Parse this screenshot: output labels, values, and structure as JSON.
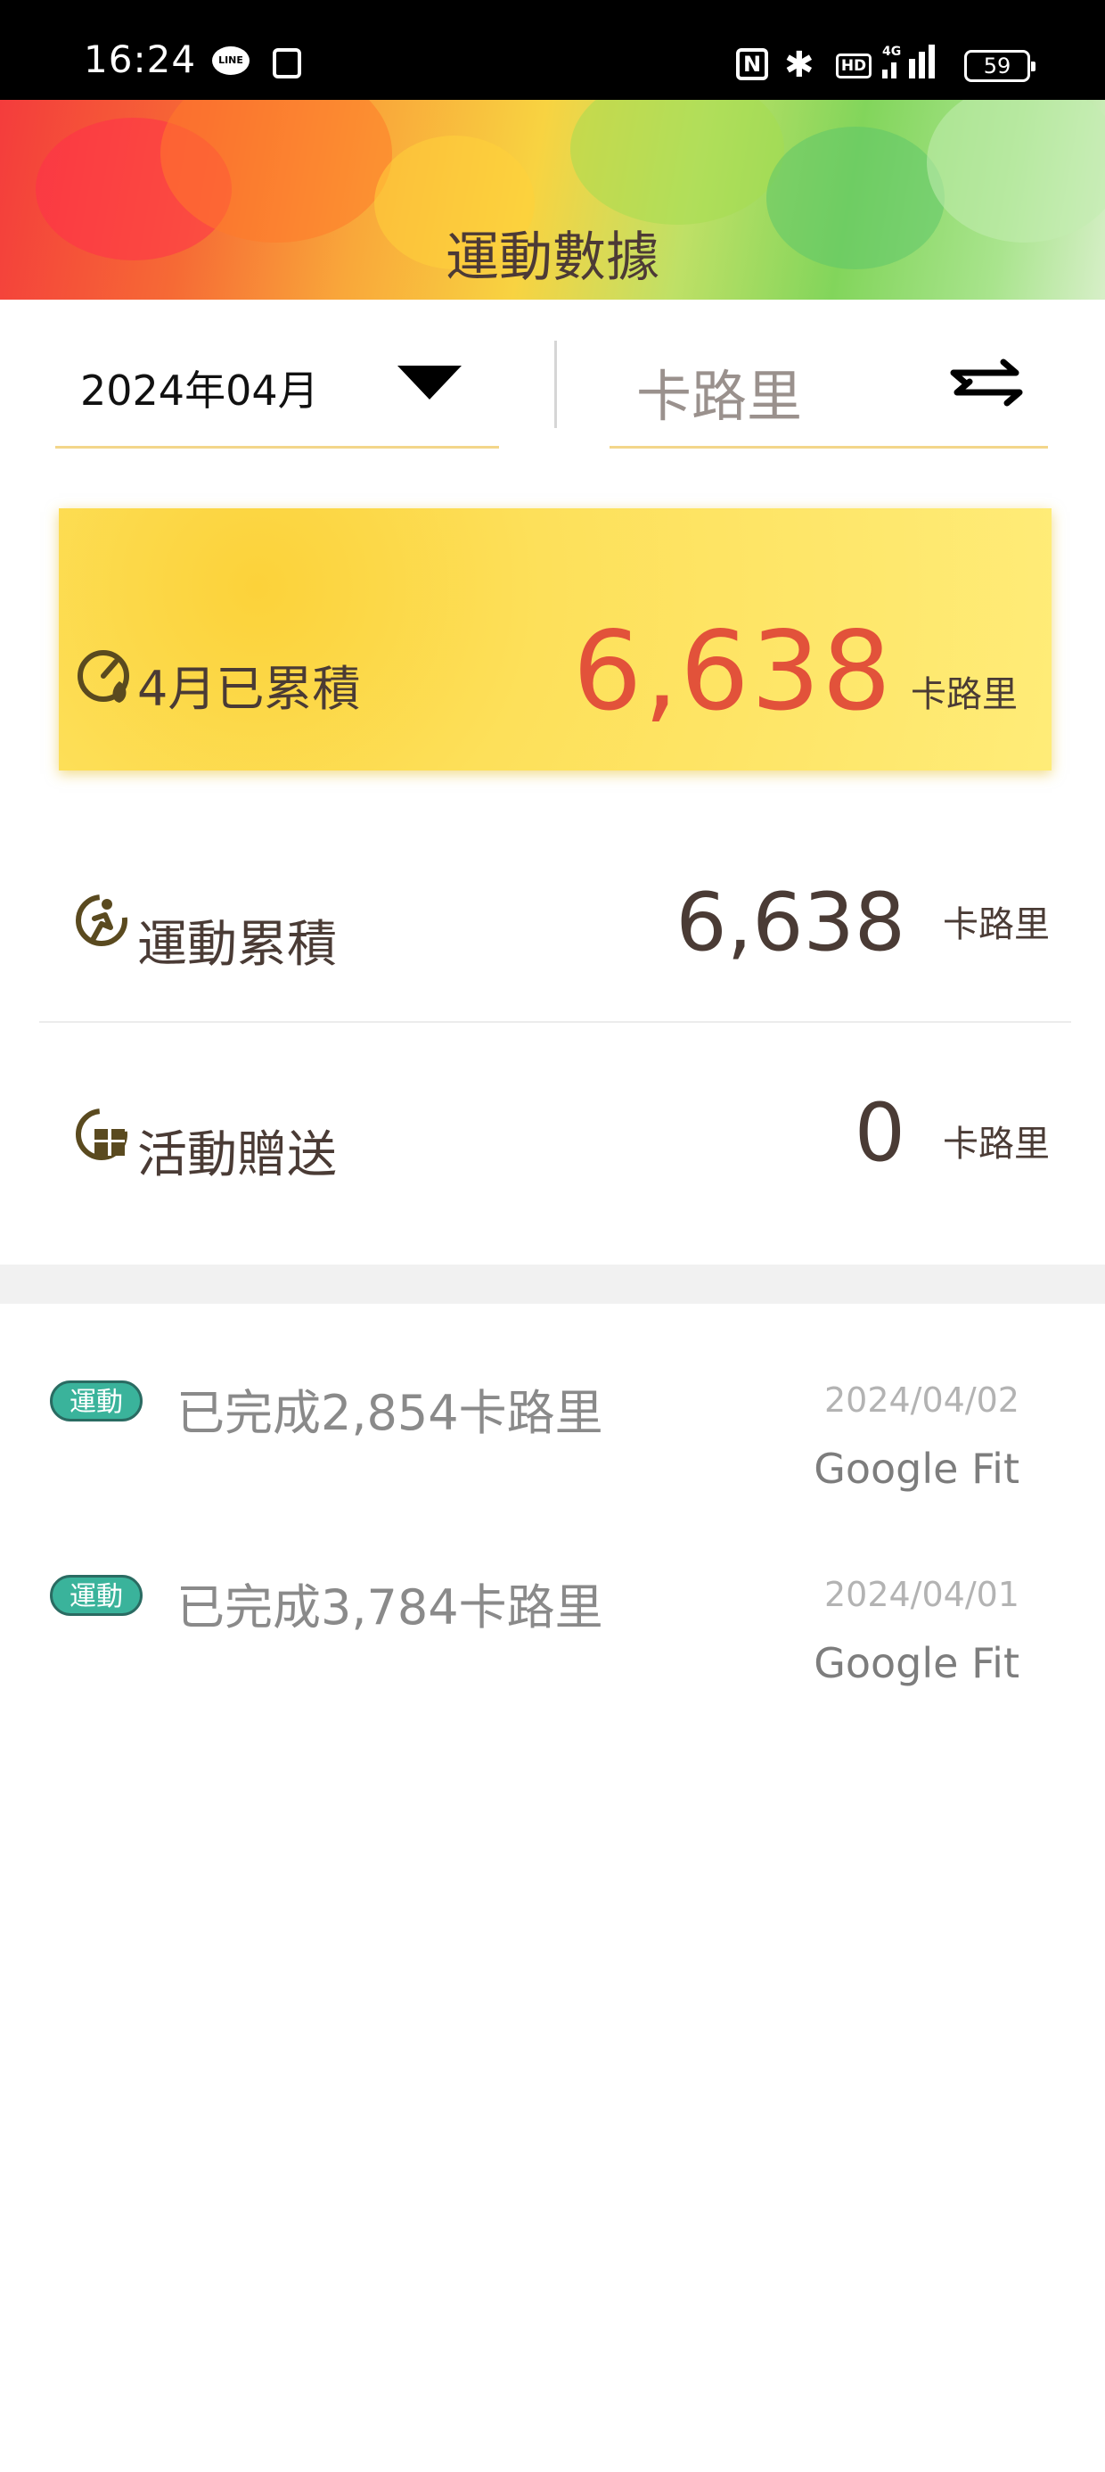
{
  "status_bar": {
    "time": "16:24",
    "line_icon_text": "LINE",
    "battery": "59",
    "icons": [
      "line-icon",
      "message-icon",
      "nfc-icon",
      "bluetooth-icon",
      "hd-icon",
      "4g-signal-icon",
      "battery-icon"
    ]
  },
  "header": {
    "title": "運動數據"
  },
  "filters": {
    "month": "2024年04月",
    "unit": "卡路里"
  },
  "summary_card": {
    "label": "4月已累積",
    "value": "6,638",
    "unit": "卡路里"
  },
  "rows": [
    {
      "label": "運動累積",
      "value": "6,638",
      "unit": "卡路里"
    },
    {
      "label": "活動贈送",
      "value": "0",
      "unit": "卡路里"
    }
  ],
  "records": [
    {
      "tag": "運動",
      "title": "已完成2,854卡路里",
      "date": "2024/04/02",
      "source": "Google Fit"
    },
    {
      "tag": "運動",
      "title": "已完成3,784卡路里",
      "date": "2024/04/01",
      "source": "Google Fit"
    }
  ],
  "colors": {
    "accent_number": "#e2523a",
    "card_yellow": "#fde05a",
    "tag_green": "#3ab39b",
    "underline": "#f3d68a"
  }
}
